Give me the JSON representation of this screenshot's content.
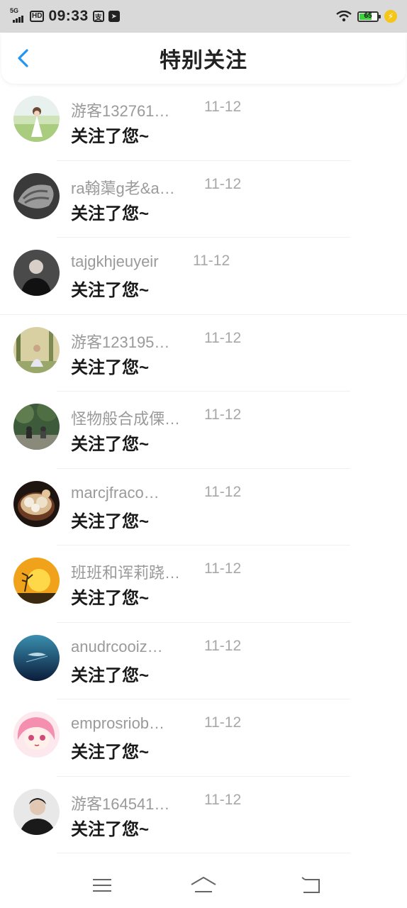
{
  "status_bar": {
    "network": "5G",
    "hd": "HD",
    "time": "09:33",
    "battery_level": "65"
  },
  "header": {
    "title": "特别关注"
  },
  "items": [
    {
      "name": "游客132761…",
      "date": "11-12",
      "message": "关注了您~",
      "avatar": "avatar-girl-field"
    },
    {
      "name": "ra翰蕖g老&a…",
      "date": "11-12",
      "message": "关注了您~",
      "avatar": "avatar-fist-bw"
    },
    {
      "name": "tajgkhjeuyeir",
      "date": "11-12",
      "message": "关注了您~",
      "avatar": "avatar-man-dark"
    },
    {
      "name": "游客123195…",
      "date": "11-12",
      "message": "关注了您~",
      "avatar": "avatar-woman-nature"
    },
    {
      "name": "怪物般合成傈…",
      "date": "11-12",
      "message": "关注了您~",
      "avatar": "avatar-couple-forest"
    },
    {
      "name": "marcjfraco…",
      "date": "11-12",
      "message": "关注了您~",
      "avatar": "avatar-food-bowl"
    },
    {
      "name": "班班和诨莉跷…",
      "date": "11-12",
      "message": "关注了您~",
      "avatar": "avatar-sunset"
    },
    {
      "name": "anudrcooiz…",
      "date": "11-12",
      "message": "关注了您~",
      "avatar": "avatar-ocean-whale"
    },
    {
      "name": "emprosriob…",
      "date": "11-12",
      "message": "关注了您~",
      "avatar": "avatar-anime-girl"
    },
    {
      "name": "游客164541…",
      "date": "11-12",
      "message": "关注了您~",
      "avatar": "avatar-man-portrait"
    }
  ]
}
